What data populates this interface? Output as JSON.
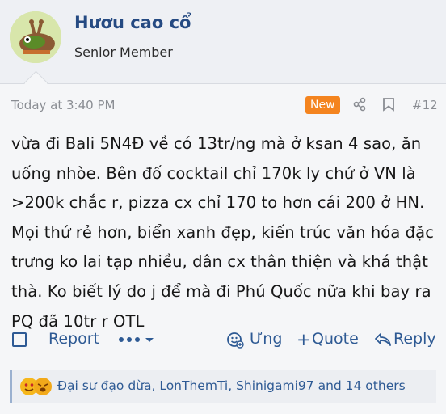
{
  "post": {
    "username": "Hươu cao cổ",
    "user_title": "Senior Member",
    "timestamp": "Today at 3:40 PM",
    "badge": "New",
    "post_number": "#12",
    "content": "vừa đi Bali 5N4Đ về có 13tr/ng mà ở ksan 4 sao, ăn uống nhòe. Bên đố cocktail chỉ 170k ly chứ ở VN là >200k chắc r, pizza cx chỉ 170 to hơn cái 200 ở HN. Mọi thứ rẻ hơn, biển xanh đẹp, kiến trúc văn hóa đặc trưng ko lai tạp nhiều, dân cx thân thiện và khá thật thà. Ko biết lý do j để mà đi Phú Quốc nữa khi bay ra PQ đã 10tr r OTL"
  },
  "actions": {
    "report": "Report",
    "react": "Ưng",
    "quote": "Quote",
    "reply": "Reply"
  },
  "reactions": {
    "text": "Đại sư đạo dừa, LonThemTi, Shinigami97 and 14 others"
  },
  "icons": [
    "avatar",
    "share-icon",
    "bookmark-icon",
    "more-icon",
    "reaction-icon",
    "plus-icon",
    "reply-icon",
    "emoji-icon"
  ],
  "colors": {
    "accent": "#2e5a94",
    "username": "#254a82",
    "badge": "#f4841f"
  }
}
